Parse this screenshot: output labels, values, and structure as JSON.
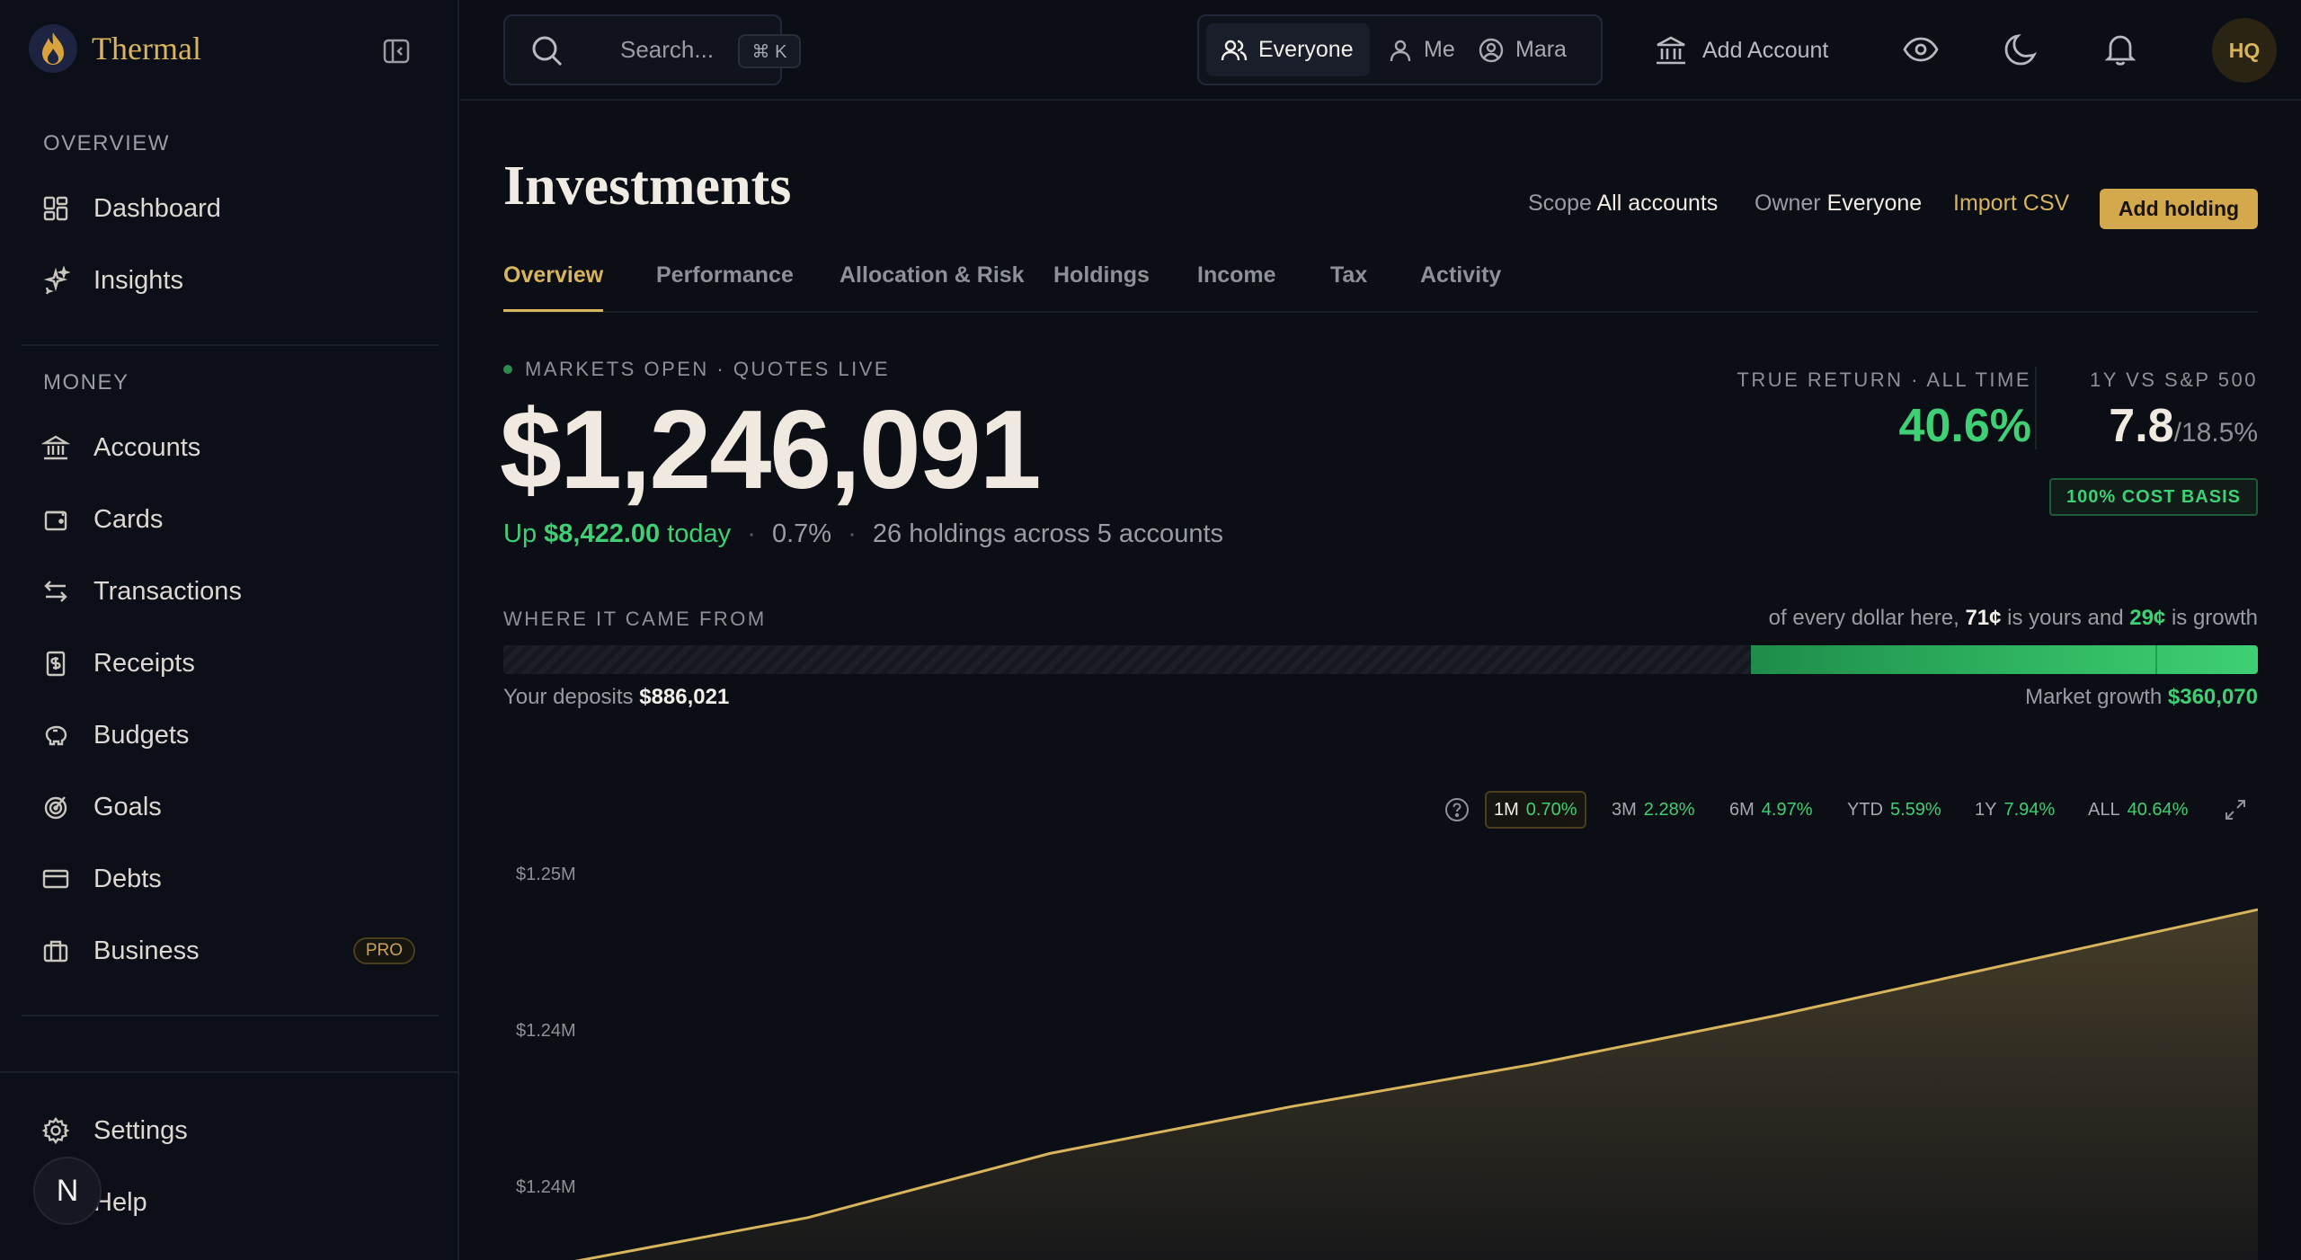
{
  "app": {
    "name": "Thermal",
    "avatar_initials": "HQ",
    "bottom_avatar": "N"
  },
  "sidebar": {
    "overview_label": "OVERVIEW",
    "money_label": "MONEY",
    "items": [
      {
        "label": "Dashboard",
        "icon": "dashboard-icon"
      },
      {
        "label": "Insights",
        "icon": "sparkles-icon"
      },
      {
        "label": "Accounts",
        "icon": "bank-icon"
      },
      {
        "label": "Cards",
        "icon": "wallet-icon"
      },
      {
        "label": "Transactions",
        "icon": "arrows-icon"
      },
      {
        "label": "Receipts",
        "icon": "receipt-icon"
      },
      {
        "label": "Budgets",
        "icon": "piggy-bank-icon"
      },
      {
        "label": "Goals",
        "icon": "target-icon"
      },
      {
        "label": "Debts",
        "icon": "credit-card-icon"
      },
      {
        "label": "Business",
        "icon": "briefcase-icon",
        "badge": "PRO"
      },
      {
        "label": "Settings",
        "icon": "gear-icon"
      },
      {
        "label": "Help",
        "icon": "help-icon"
      }
    ]
  },
  "topbar": {
    "search_placeholder": "Search...",
    "search_shortcut": "⌘ K",
    "segments": [
      {
        "label": "Everyone",
        "active": true
      },
      {
        "label": "Me",
        "active": false
      },
      {
        "label": "Mara",
        "active": false
      }
    ],
    "add_account": "Add Account"
  },
  "page": {
    "title": "Investments",
    "scope_key": "Scope",
    "scope_value": "All accounts",
    "owner_key": "Owner",
    "owner_value": "Everyone",
    "import_csv": "Import CSV",
    "add_holding": "Add holding",
    "tabs": [
      "Overview",
      "Performance",
      "Allocation & Risk",
      "Holdings",
      "Income",
      "Tax",
      "Activity"
    ],
    "active_tab": "Overview"
  },
  "summary": {
    "market_status": "MARKETS OPEN · QUOTES LIVE",
    "total_value": "$1,246,091",
    "up_prefix": "Up",
    "up_amount": "$8,422.00",
    "up_suffix": "today",
    "pct_today": "0.7%",
    "holdings_note": "26 holdings across 5 accounts",
    "true_return_label": "TRUE RETURN · ALL TIME",
    "true_return_value": "40.6%",
    "vs_label": "1Y VS S&P 500",
    "vs_value": "7.8",
    "vs_benchmark": "/18.5%",
    "cost_basis_badge": "100% COST BASIS"
  },
  "composition": {
    "label": "WHERE IT CAME FROM",
    "note_prefix": "of every dollar here,",
    "yours_cents": "71¢",
    "note_mid": "is yours and",
    "growth_cents": "29¢",
    "note_suffix": "is growth",
    "deposits_label": "Your deposits",
    "deposits_value": "$886,021",
    "growth_label": "Market growth",
    "growth_value": "$360,070",
    "deposit_fraction": 0.711
  },
  "ranges": [
    {
      "label": "1M",
      "pct": "0.70%",
      "active": true
    },
    {
      "label": "3M",
      "pct": "2.28%",
      "active": false
    },
    {
      "label": "6M",
      "pct": "4.97%",
      "active": false
    },
    {
      "label": "YTD",
      "pct": "5.59%",
      "active": false
    },
    {
      "label": "1Y",
      "pct": "7.94%",
      "active": false
    },
    {
      "label": "ALL",
      "pct": "40.64%",
      "active": false
    }
  ],
  "colors": {
    "accent": "#d8b45c",
    "positive": "#3fcf74",
    "background": "#0b0e15"
  },
  "chart_data": {
    "type": "area",
    "y_tick_labels": [
      "$1.25M",
      "$1.24M",
      "$1.24M"
    ],
    "y_ticks": [
      1250000,
      1240000,
      1230000
    ],
    "x": [
      0,
      1,
      2,
      3,
      4,
      5,
      6,
      7
    ],
    "values": [
      1225500,
      1228400,
      1232500,
      1235500,
      1238200,
      1241300,
      1244700,
      1248100
    ],
    "grid": false
  }
}
